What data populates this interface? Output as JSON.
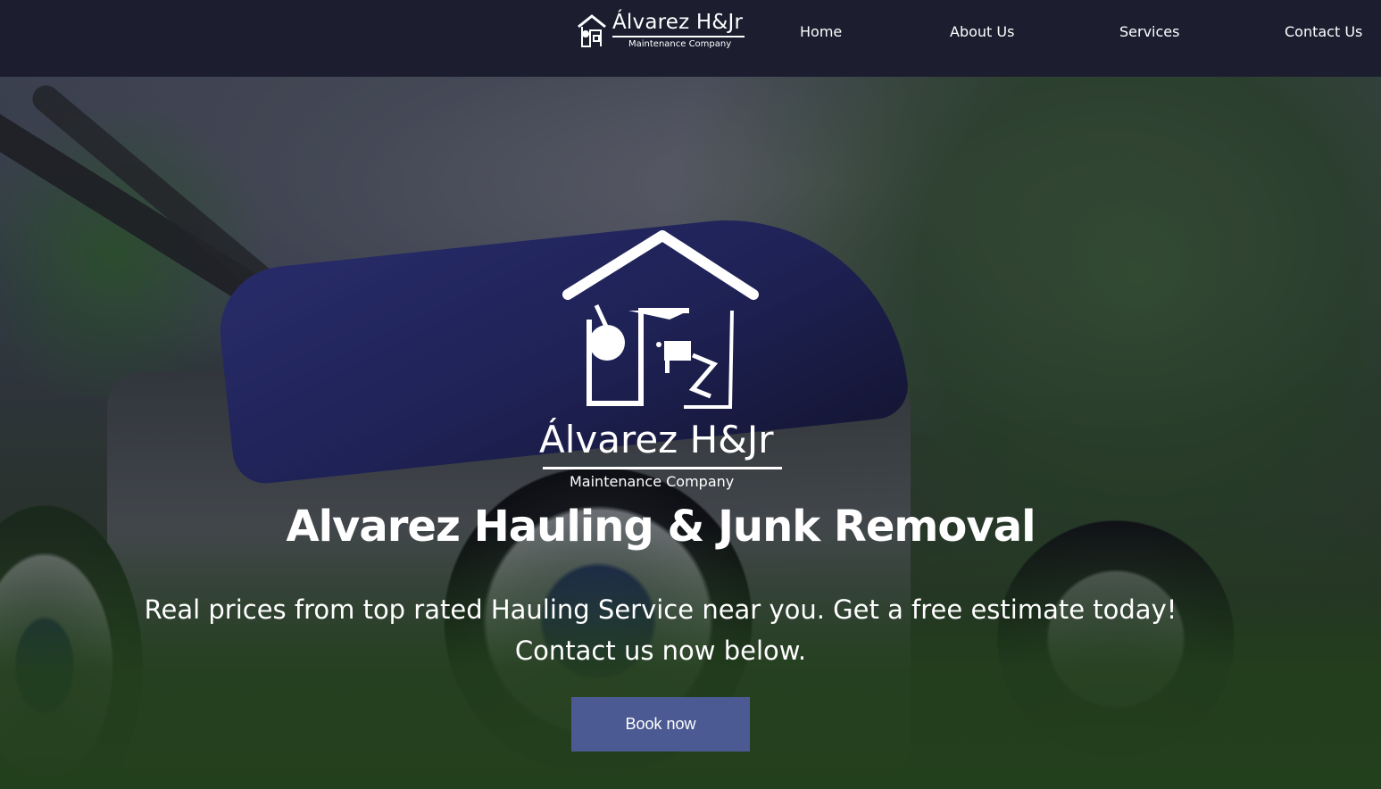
{
  "header": {
    "logo": {
      "brand": "Álvarez H&Jr",
      "subtitle": "Maintenance Company",
      "icon": "house-logo-icon"
    },
    "nav": [
      {
        "label": "Home"
      },
      {
        "label": "About Us"
      },
      {
        "label": "Services"
      },
      {
        "label": "Contact Us"
      }
    ]
  },
  "hero": {
    "logo": {
      "brand": "Álvarez H&Jr",
      "subtitle": "Maintenance Company",
      "icon": "house-logo-icon"
    },
    "title": "Alvarez Hauling & Junk Removal",
    "subtitle_line1": "Real prices from top rated Hauling Service near you. Get a free estimate today!",
    "subtitle_line2": "Contact us now below.",
    "cta_label": "Book now",
    "background_image": "lawn-mower-on-grass"
  },
  "colors": {
    "header_bg": "#1c1e30",
    "button_bg": "#4c5a93",
    "text": "#ffffff"
  }
}
